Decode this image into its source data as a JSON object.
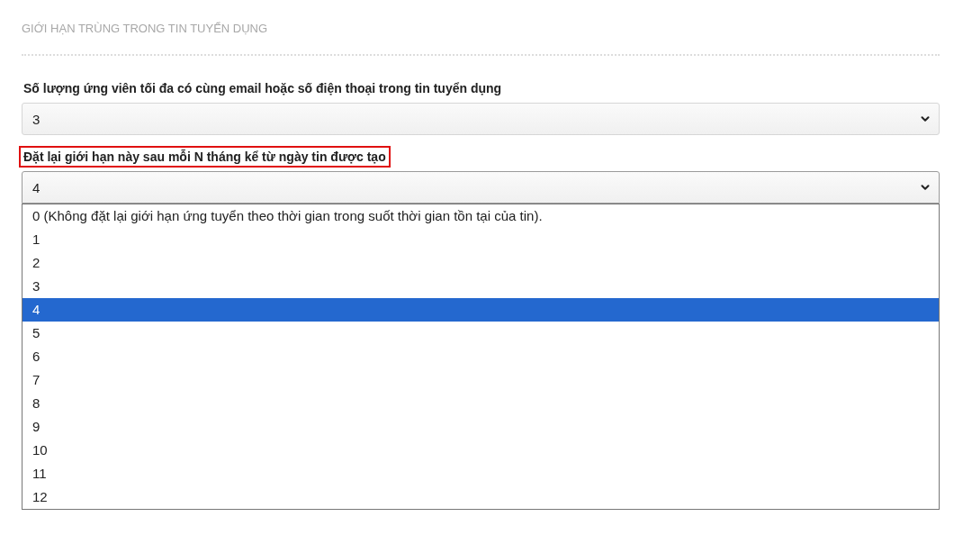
{
  "section_title": "GIỚI HẠN TRÙNG TRONG TIN TUYỂN DỤNG",
  "fields": [
    {
      "label": "Số lượng ứng viên tối đa có cùng email hoặc số điện thoại trong tin tuyển dụng",
      "highlighted": false,
      "value": "3",
      "expanded": false
    },
    {
      "label": "Đặt lại giới hạn này sau mỗi N tháng kể từ ngày tin được tạo",
      "highlighted": true,
      "value": "4",
      "expanded": true,
      "options": [
        {
          "label": "0 (Không đặt lại giới hạn ứng tuyển theo thời gian trong suốt thời gian tồn tại của tin).",
          "selected": false
        },
        {
          "label": "1",
          "selected": false
        },
        {
          "label": "2",
          "selected": false
        },
        {
          "label": "3",
          "selected": false
        },
        {
          "label": "4",
          "selected": true
        },
        {
          "label": "5",
          "selected": false
        },
        {
          "label": "6",
          "selected": false
        },
        {
          "label": "7",
          "selected": false
        },
        {
          "label": "8",
          "selected": false
        },
        {
          "label": "9",
          "selected": false
        },
        {
          "label": "10",
          "selected": false
        },
        {
          "label": "11",
          "selected": false
        },
        {
          "label": "12",
          "selected": false
        }
      ]
    }
  ]
}
